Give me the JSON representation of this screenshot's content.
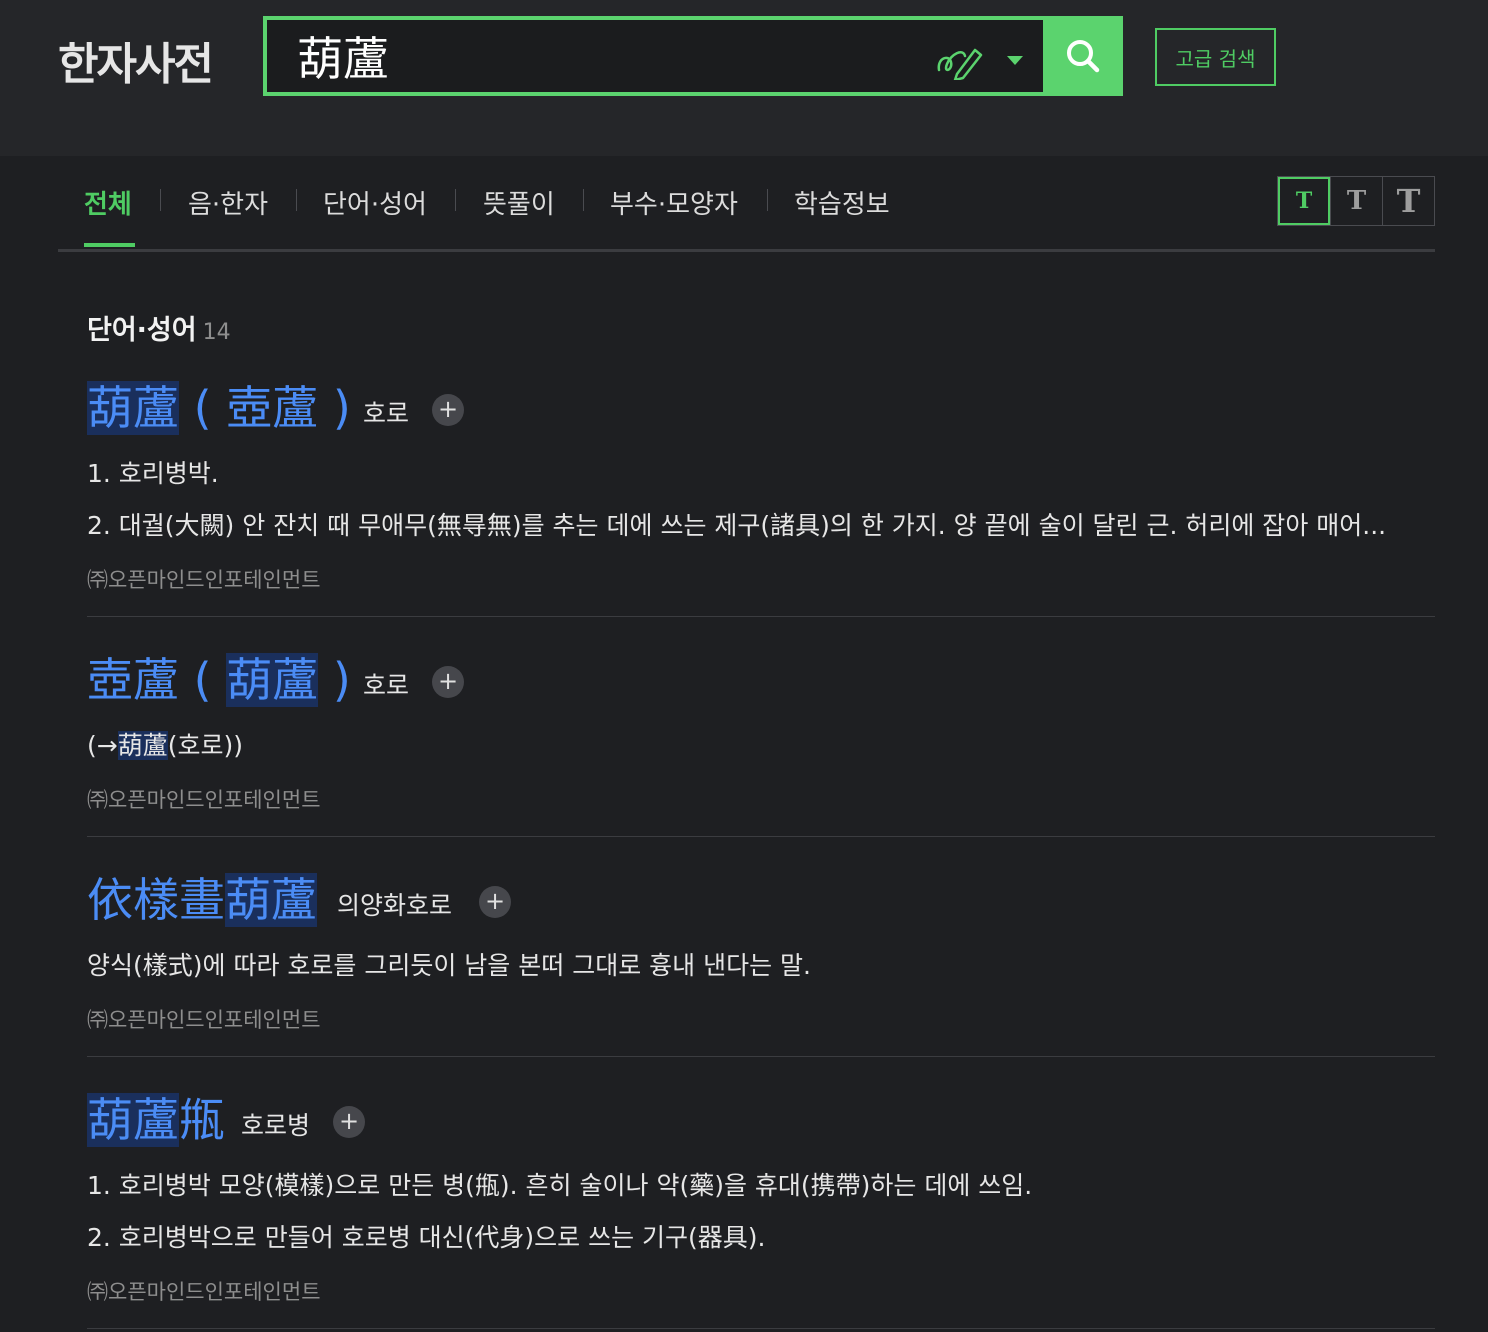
{
  "header": {
    "logo": "한자사전",
    "search_value": "葫蘆",
    "advanced_label": "고급 검색"
  },
  "tabs": [
    "전체",
    "음·한자",
    "단어·성어",
    "뜻풀이",
    "부수·모양자",
    "학습정보"
  ],
  "font_size_buttons": [
    "T",
    "T",
    "T"
  ],
  "section": {
    "title": "단어·성어",
    "count": "14"
  },
  "entries": [
    {
      "hanja": "葫蘆",
      "alt": "壺蘆",
      "reading": "호로",
      "defs": [
        "1. 호리병박.",
        "2. 대궐(大闕) 안 잔치 때 무애무(無㝵無)를 추는 데에 쓰는 제구(諸具)의 한 가지. 양 끝에 술이 달린 근. 허리에 잡아 매어..."
      ],
      "source": "㈜오픈마인드인포테인먼트"
    },
    {
      "hanja": "壺蘆",
      "alt": "葫蘆",
      "reading": "호로",
      "def_prefix": "(→",
      "def_link": "葫蘆",
      "def_suffix": "(호로))",
      "source": "㈜오픈마인드인포테인먼트"
    },
    {
      "hanja_plain": "依樣畫",
      "hanja": "葫蘆",
      "reading": "의양화호로",
      "defs": [
        "양식(樣式)에 따라 호로를 그리듯이 남을 본떠 그대로 흉내 낸다는 말."
      ],
      "source": "㈜오픈마인드인포테인먼트"
    },
    {
      "hanja": "葫蘆",
      "hanja_plain": "甁",
      "reading": "호로병",
      "defs": [
        "1. 호리병박 모양(模樣)으로 만든 병(甁). 흔히 술이나 약(藥)을 휴대(携帶)하는 데에 쓰임.",
        "2. 호리병박으로 만들어 호로병 대신(代身)으로 쓰는 기구(器具)."
      ],
      "source": "㈜오픈마인드인포테인먼트"
    }
  ],
  "colors": {
    "accent": "#4fcc63",
    "hanja_link": "#4b8cf5",
    "background": "#1e1f22"
  },
  "icons": {
    "handwriting": "handwriting-pen-icon",
    "search": "magnifier-icon",
    "dropdown": "caret-down-icon",
    "add": "plus-icon"
  }
}
